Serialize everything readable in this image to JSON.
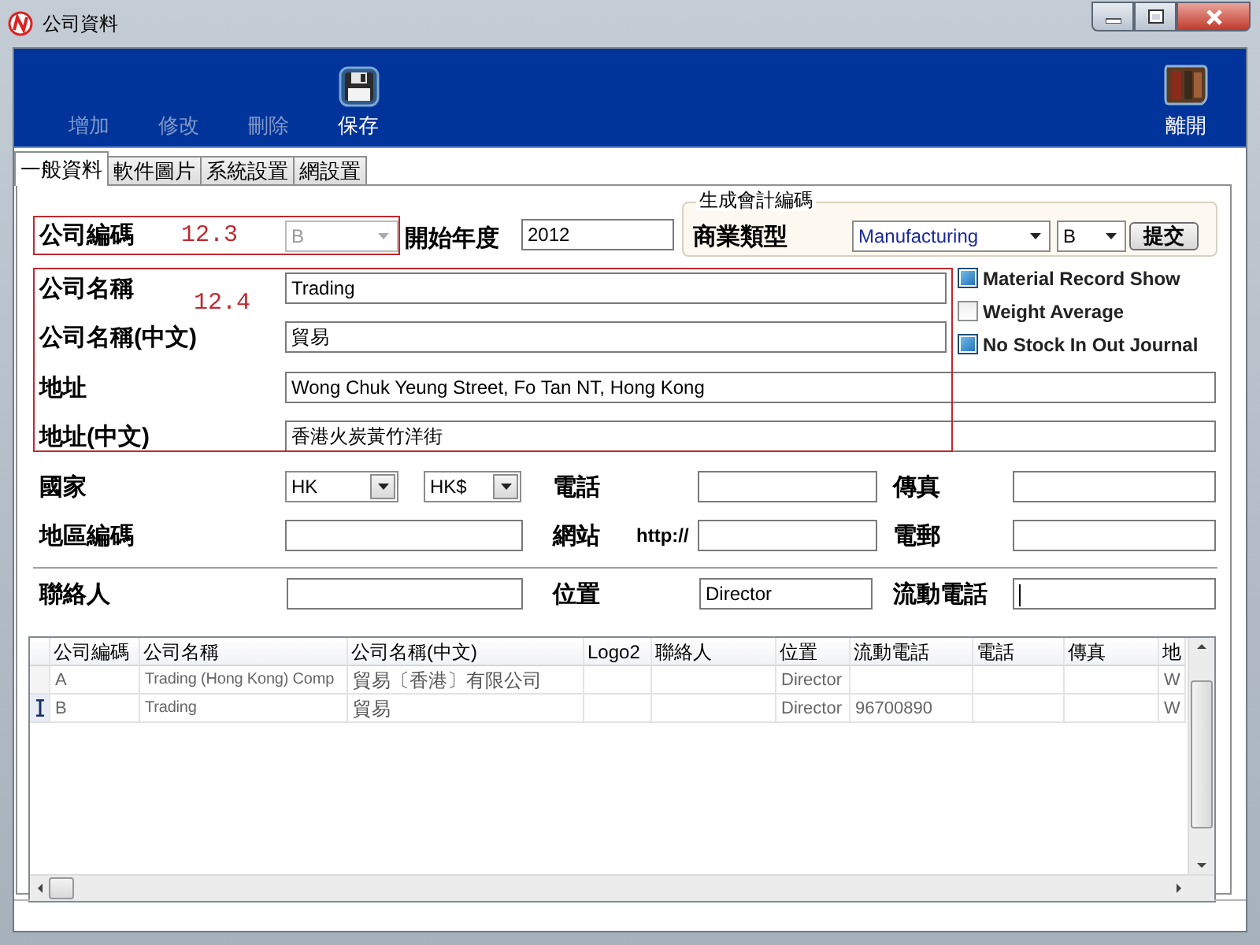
{
  "window": {
    "title": "公司資料"
  },
  "toolbar": {
    "buttons": [
      {
        "label": "增加",
        "disabled": true
      },
      {
        "label": "修改",
        "disabled": true
      },
      {
        "label": "刪除",
        "disabled": true
      },
      {
        "label": "保存",
        "disabled": false,
        "kind": "save"
      }
    ],
    "exit": {
      "label": "離開"
    }
  },
  "tabs": [
    {
      "label": "一般資料",
      "selected": true
    },
    {
      "label": "軟件圖片",
      "selected": false
    },
    {
      "label": "系統設置",
      "selected": false
    },
    {
      "label": "網設置",
      "selected": false
    }
  ],
  "form": {
    "company_code": {
      "label": "公司編碼",
      "annotation": "12.3",
      "value": "B",
      "disabled": true
    },
    "start_year": {
      "label": "開始年度",
      "value": "2012"
    },
    "account_code_group": {
      "title": "生成會計編碼",
      "label": "商業類型",
      "business_type": "Manufacturing",
      "code": "B",
      "button": "提交"
    },
    "name_annotation": "12.4",
    "name": {
      "label": "公司名稱",
      "value": "Trading"
    },
    "name_chinese": {
      "label": "公司名稱(中文)",
      "value": "貿易"
    },
    "options": [
      {
        "label": "Material Record Show",
        "checked": true
      },
      {
        "label": "Weight Average",
        "checked": false
      },
      {
        "label": "No Stock In Out Journal",
        "checked": true
      }
    ],
    "address": {
      "label": "地址",
      "value": "Wong Chuk Yeung Street, Fo Tan NT, Hong Kong"
    },
    "address_chinese": {
      "label": "地址(中文)",
      "value": "香港火炭黃竹洋街"
    },
    "country": {
      "label": "國家",
      "value": "HK",
      "currency": "HK$"
    },
    "phone": {
      "label": "電話"
    },
    "fax": {
      "label": "傳真"
    },
    "area_code": {
      "label": "地區編碼"
    },
    "website": {
      "label": "網站",
      "prefix": "http://"
    },
    "email": {
      "label": "電郵"
    },
    "contact": {
      "label": "聯絡人"
    },
    "position": {
      "label": "位置",
      "value": "Director"
    },
    "mobile": {
      "label": "流動電話"
    }
  },
  "grid": {
    "columns": [
      "公司編碼",
      "公司名稱",
      "公司名稱(中文)",
      "Logo2",
      "聯絡人",
      "位置",
      "流動電話",
      "電話",
      "傳真",
      "地"
    ],
    "rows": [
      {
        "selected": false,
        "cells": [
          "A",
          "Trading (Hong Kong) Comp",
          "貿易〔香港〕有限公司",
          null,
          null,
          "Director",
          null,
          null,
          null,
          "W"
        ]
      },
      {
        "selected": true,
        "cells": [
          "B",
          " Trading",
          "貿易",
          null,
          null,
          "Director",
          "96700890",
          null,
          null,
          "W"
        ]
      }
    ]
  }
}
